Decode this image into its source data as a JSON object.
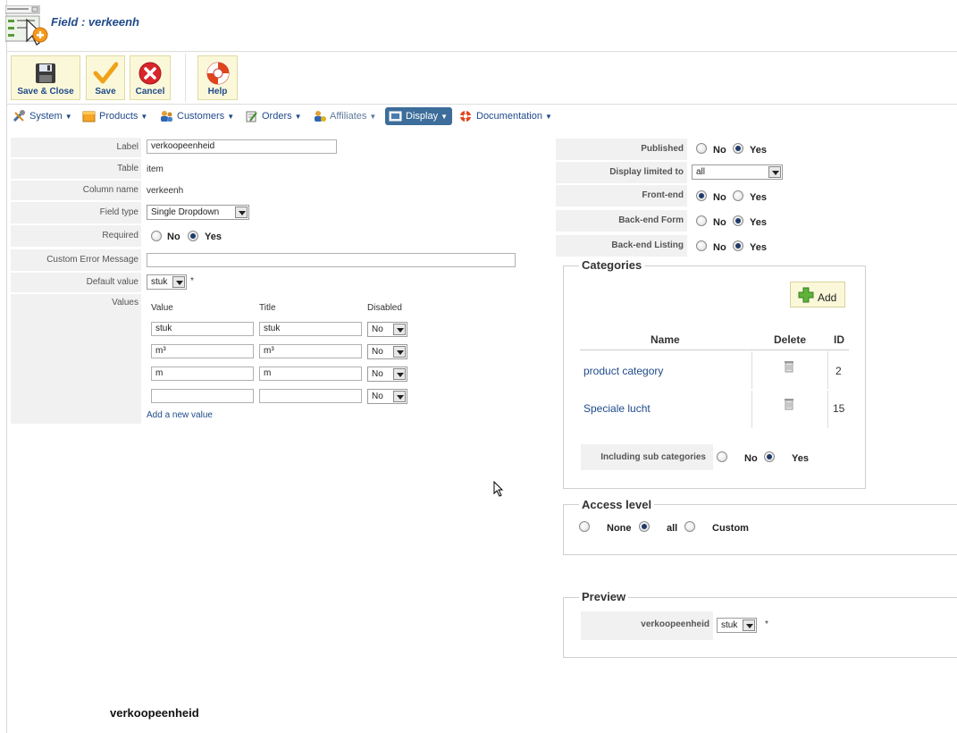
{
  "header": {
    "title": "Field : verkeenh"
  },
  "toolbar": {
    "save_close": "Save & Close",
    "save": "Save",
    "cancel": "Cancel",
    "help": "Help"
  },
  "menu": {
    "system": "System",
    "products": "Products",
    "customers": "Customers",
    "orders": "Orders",
    "affiliates": "Affiliates",
    "display": "Display",
    "documentation": "Documentation"
  },
  "form": {
    "label_label": "Label",
    "label_value": "verkoopeenheid",
    "table_label": "Table",
    "table_value": "item",
    "column_label": "Column name",
    "column_value": "verkeenh",
    "fieldtype_label": "Field type",
    "fieldtype_value": "Single Dropdown",
    "required_label": "Required",
    "required_no": "No",
    "required_yes": "Yes",
    "error_label": "Custom Error Message",
    "error_value": "",
    "default_label": "Default value",
    "default_value": "stuk",
    "default_star": "*",
    "values_label": "Values",
    "values_headers": {
      "value": "Value",
      "title": "Title",
      "disabled": "Disabled"
    },
    "values_rows": [
      {
        "value": "stuk",
        "title": "stuk",
        "disabled": "No"
      },
      {
        "value": "m³",
        "title": "m³",
        "disabled": "No"
      },
      {
        "value": "m",
        "title": "m",
        "disabled": "No"
      },
      {
        "value": "",
        "title": "",
        "disabled": "No"
      }
    ],
    "add_value_link": "Add a new value"
  },
  "right": {
    "published_label": "Published",
    "display_limited_label": "Display limited to",
    "display_limited_value": "all",
    "frontend_label": "Front-end",
    "backend_form_label": "Back-end Form",
    "backend_listing_label": "Back-end Listing",
    "no": "No",
    "yes": "Yes"
  },
  "categories": {
    "legend": "Categories",
    "add_button": "Add",
    "col_name": "Name",
    "col_delete": "Delete",
    "col_id": "ID",
    "rows": [
      {
        "name": "product category",
        "id": "2"
      },
      {
        "name": "Speciale lucht",
        "id": "15"
      }
    ],
    "sub_label": "Including sub categories",
    "sub_no": "No",
    "sub_yes": "Yes"
  },
  "access": {
    "legend": "Access level",
    "none": "None",
    "all": "all",
    "custom": "Custom"
  },
  "preview": {
    "legend": "Preview",
    "field_label": "verkoopeenheid",
    "select_value": "stuk",
    "star": "*"
  },
  "footer": {
    "label": "verkoopeenheid"
  }
}
